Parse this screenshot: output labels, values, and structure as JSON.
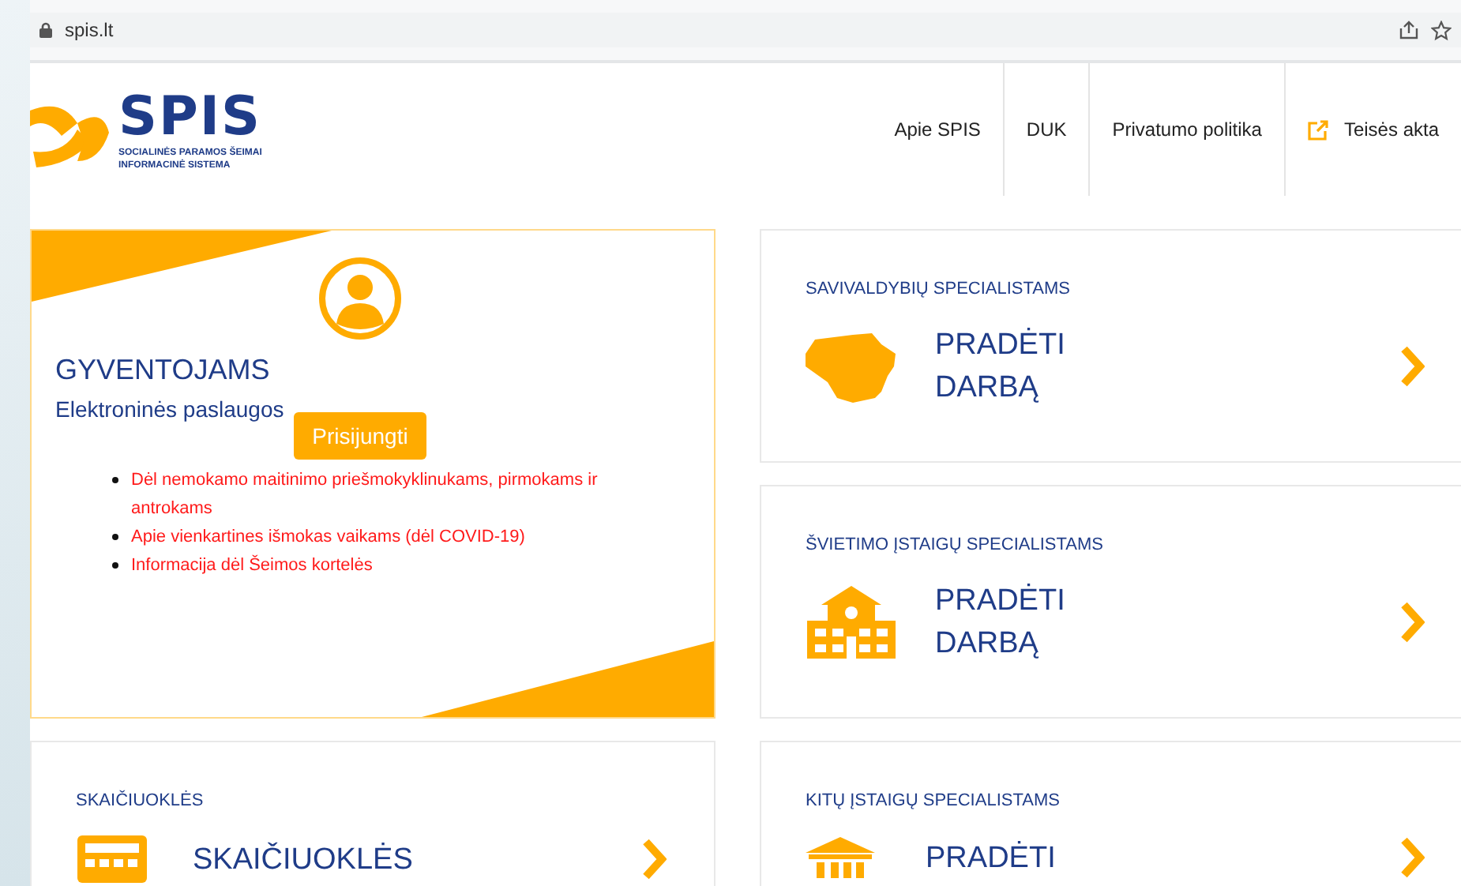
{
  "browser": {
    "url": "spis.lt"
  },
  "logo": {
    "name": "SPIS",
    "subtitle_lines": [
      "SOCIALINĖS PARAMOS ŠEIMAI",
      "INFORMACINĖ SISTEMA"
    ]
  },
  "nav": [
    {
      "label": "Apie SPIS",
      "external": false
    },
    {
      "label": "DUK",
      "external": false
    },
    {
      "label": "Privatumo politika",
      "external": false
    },
    {
      "label": "Teisės akta",
      "external": true
    }
  ],
  "residents_card": {
    "title": "GYVENTOJAMS",
    "subtitle": "Elektroninės paslaugos",
    "button": "Prisijungti",
    "links": [
      "Dėl nemokamo maitinimo priešmokyklinukams, pirmokams ir antrokams",
      "Apie vienkartines išmokas vaikams (dėl COVID-19)",
      "Informacija dėl Šeimos kortelės"
    ]
  },
  "calculator_card": {
    "heading": "SKAIČIUOKLĖS",
    "kind": "calculator",
    "action_lines": [
      "SKAIČIUOKLĖS"
    ]
  },
  "cards": [
    {
      "heading": "SAVIVALDYBIŲ SPECIALISTAMS",
      "kind": "map",
      "action_lines": [
        "PRADĖTI",
        "DARBĄ"
      ]
    },
    {
      "heading": "ŠVIETIMO ĮSTAIGŲ SPECIALISTAMS",
      "kind": "school",
      "action_lines": [
        "PRADĖTI",
        "DARBĄ"
      ]
    },
    {
      "heading": "KITŲ ĮSTAIGŲ SPECIALISTAMS",
      "kind": "institution",
      "action_lines": [
        "PRADĖTI"
      ]
    }
  ]
}
